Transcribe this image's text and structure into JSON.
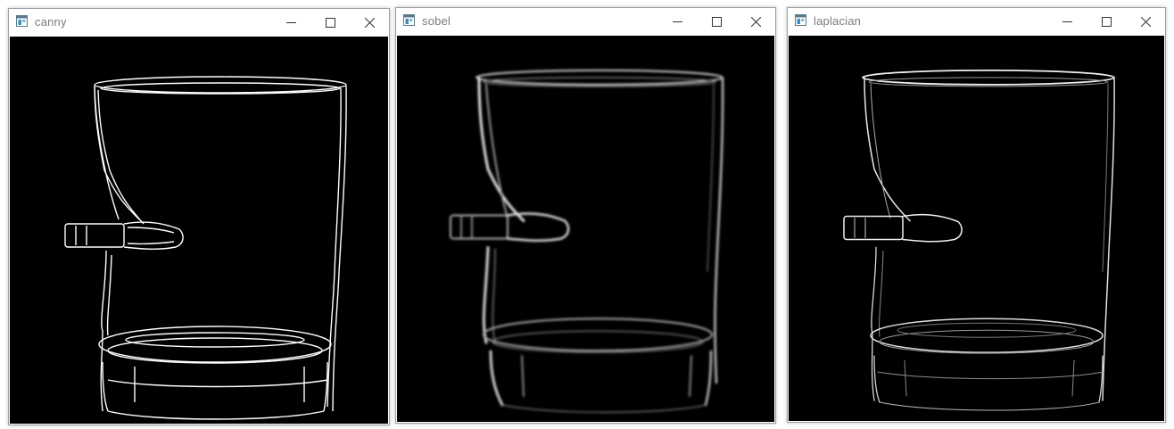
{
  "windows": [
    {
      "title": "canny",
      "image_description": "canny-edge-image"
    },
    {
      "title": "sobel",
      "image_description": "sobel-edge-image"
    },
    {
      "title": "laplacian",
      "image_description": "laplacian-edge-image"
    }
  ],
  "controls": {
    "icons": [
      "minimize-icon",
      "maximize-icon",
      "close-icon"
    ]
  },
  "colors": {
    "canvas": "#000000",
    "edge": "#ffffff",
    "titlebar": "#ffffff",
    "title_text": "#7a7a7a"
  }
}
